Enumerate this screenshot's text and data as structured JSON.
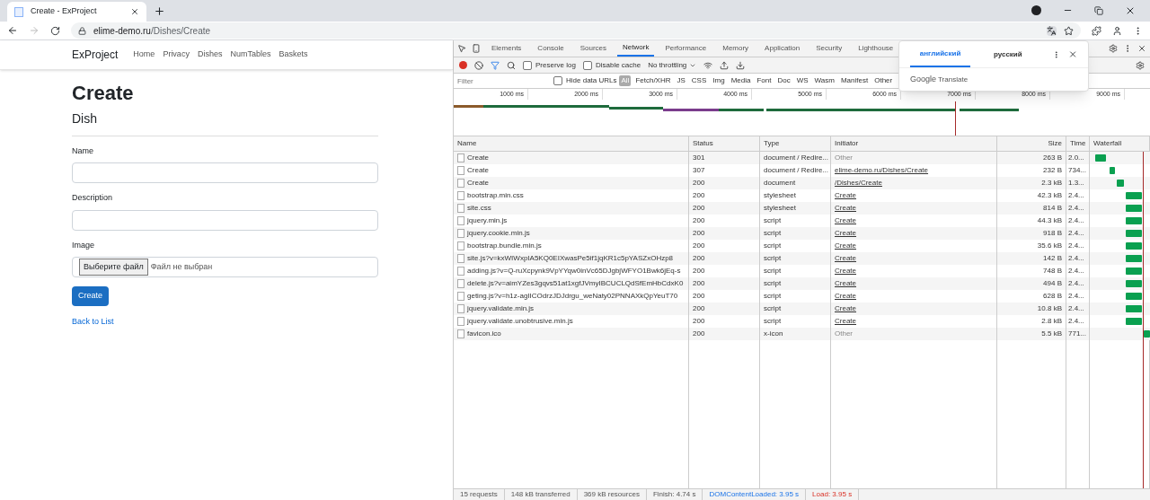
{
  "browser": {
    "tab_title": "Create - ExProject",
    "address_host": "elime-demo.ru",
    "address_path": "/Dishes/Create"
  },
  "page": {
    "brand": "ExProject",
    "nav": [
      "Home",
      "Privacy",
      "Dishes",
      "NumTables",
      "Baskets"
    ],
    "title": "Create",
    "subtitle": "Dish",
    "fields": [
      {
        "label": "Name",
        "kind": "text"
      },
      {
        "label": "Description",
        "kind": "text"
      },
      {
        "label": "Image",
        "kind": "file",
        "button": "Выберите файл",
        "status": "Файл не выбран"
      }
    ],
    "submit": "Create",
    "back_link": "Back to List"
  },
  "devtools": {
    "tabs": [
      {
        "label": "Elements",
        "selected": false
      },
      {
        "label": "Console",
        "selected": false
      },
      {
        "label": "Sources",
        "selected": false
      },
      {
        "label": "Network",
        "selected": true
      },
      {
        "label": "Performance",
        "selected": false
      },
      {
        "label": "Memory",
        "selected": false
      },
      {
        "label": "Application",
        "selected": false
      },
      {
        "label": "Security",
        "selected": false
      },
      {
        "label": "Lighthouse",
        "selected": false
      }
    ],
    "recording": true,
    "toolbar": {
      "preserve_log": {
        "label": "Preserve log",
        "checked": false
      },
      "disable_cache": {
        "label": "Disable cache",
        "checked": false
      },
      "throttling": "No throttling"
    },
    "filter": {
      "placeholder": "Filter",
      "hide_data_urls": {
        "label": "Hide data URLs",
        "checked": false
      },
      "types": [
        {
          "label": "All",
          "selected": true
        },
        {
          "label": "Fetch/XHR",
          "selected": false
        },
        {
          "label": "JS",
          "selected": false
        },
        {
          "label": "CSS",
          "selected": false
        },
        {
          "label": "Img",
          "selected": false
        },
        {
          "label": "Media",
          "selected": false
        },
        {
          "label": "Font",
          "selected": false
        },
        {
          "label": "Doc",
          "selected": false
        },
        {
          "label": "WS",
          "selected": false
        },
        {
          "label": "Wasm",
          "selected": false
        },
        {
          "label": "Manifest",
          "selected": false
        },
        {
          "label": "Other",
          "selected": false
        }
      ]
    },
    "overview_ticks": [
      "1000 ms",
      "2000 ms",
      "3000 ms",
      "4000 ms",
      "5000 ms",
      "6000 ms",
      "7000 ms",
      "8000 ms",
      "9000 ms"
    ],
    "columns": [
      "Name",
      "Status",
      "Type",
      "Initiator",
      "Size",
      "Time",
      "Waterfall"
    ],
    "rows": [
      {
        "name": "Create",
        "status": "301",
        "type": "document / Redire...",
        "initiator": "Other",
        "kind": "plain",
        "size": "263 B",
        "time": "2.0..."
      },
      {
        "name": "Create",
        "status": "307",
        "type": "document / Redire...",
        "initiator": "elime-demo.ru/Dishes/Create",
        "kind": "link",
        "size": "232 B",
        "time": "734..."
      },
      {
        "name": "Create",
        "status": "200",
        "type": "document",
        "initiator": "/Dishes/Create",
        "kind": "link",
        "size": "2.3 kB",
        "time": "1.3..."
      },
      {
        "name": "bootstrap.min.css",
        "status": "200",
        "type": "stylesheet",
        "initiator": "Create",
        "kind": "link",
        "size": "42.3 kB",
        "time": "2.4..."
      },
      {
        "name": "site.css",
        "status": "200",
        "type": "stylesheet",
        "initiator": "Create",
        "kind": "link",
        "size": "814 B",
        "time": "2.4..."
      },
      {
        "name": "jquery.min.js",
        "status": "200",
        "type": "script",
        "initiator": "Create",
        "kind": "link",
        "size": "44.3 kB",
        "time": "2.4..."
      },
      {
        "name": "jquery.cookie.min.js",
        "status": "200",
        "type": "script",
        "initiator": "Create",
        "kind": "link",
        "size": "918 B",
        "time": "2.4..."
      },
      {
        "name": "bootstrap.bundle.min.js",
        "status": "200",
        "type": "script",
        "initiator": "Create",
        "kind": "link",
        "size": "35.6 kB",
        "time": "2.4..."
      },
      {
        "name": "site.js?v=kxWIWxpIA5KQ0EIXwasPe5if1jqKR1c5pYASZxOHzp8",
        "status": "200",
        "type": "script",
        "initiator": "Create",
        "kind": "link",
        "size": "142 B",
        "time": "2.4..."
      },
      {
        "name": "adding.js?v=Q-ruXcpynk9VpYYqw0inVc65DJgbjWFYO1Bwk6jEq-s",
        "status": "200",
        "type": "script",
        "initiator": "Create",
        "kind": "link",
        "size": "748 B",
        "time": "2.4..."
      },
      {
        "name": "delete.js?v=aimYZes3gqvs51at1xgfJVmyIBCUCLQdSfEmHbCdxK0",
        "status": "200",
        "type": "script",
        "initiator": "Create",
        "kind": "link",
        "size": "494 B",
        "time": "2.4..."
      },
      {
        "name": "geting.js?v=h1z-agIICOdrzJDJdrgu_weNaty02PNNAXkQpYeuT70",
        "status": "200",
        "type": "script",
        "initiator": "Create",
        "kind": "link",
        "size": "628 B",
        "time": "2.4..."
      },
      {
        "name": "jquery.validate.min.js",
        "status": "200",
        "type": "script",
        "initiator": "Create",
        "kind": "link",
        "size": "10.8 kB",
        "time": "2.4..."
      },
      {
        "name": "jquery.validate.unobtrusive.min.js",
        "status": "200",
        "type": "script",
        "initiator": "Create",
        "kind": "link",
        "size": "2.8 kB",
        "time": "2.4..."
      },
      {
        "name": "favicon.ico",
        "status": "200",
        "type": "x-icon",
        "initiator": "Other",
        "kind": "plain",
        "size": "5.5 kB",
        "time": "771..."
      }
    ],
    "status_bar": [
      {
        "text": "15 requests",
        "kind": "plain"
      },
      {
        "text": "148 kB transferred",
        "kind": "plain"
      },
      {
        "text": "369 kB resources",
        "kind": "plain"
      },
      {
        "text": "Finish: 4.74 s",
        "kind": "plain"
      },
      {
        "text": "DOMContentLoaded: 3.95 s",
        "kind": "dom"
      },
      {
        "text": "Load: 3.95 s",
        "kind": "load"
      }
    ]
  },
  "translate_popup": {
    "languages": [
      {
        "label": "английский",
        "selected": true
      },
      {
        "label": "русский",
        "selected": false
      }
    ],
    "brand_google": "Google",
    "brand_translate": "Translate"
  }
}
